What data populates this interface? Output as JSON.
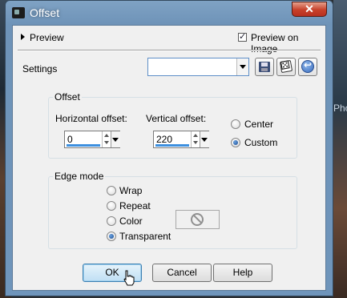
{
  "window": {
    "title": "Offset",
    "close_label": "✕"
  },
  "preview": {
    "label": "Preview",
    "preview_on_image_label": "Preview on Image",
    "preview_on_image_checked": true
  },
  "settings": {
    "label": "Settings",
    "selected": ""
  },
  "offset_group": {
    "title": "Offset",
    "horizontal_label": "Horizontal offset:",
    "horizontal_value": "0",
    "vertical_label": "Vertical offset:",
    "vertical_value": "220",
    "center_label": "Center",
    "custom_label": "Custom",
    "selected": "Custom"
  },
  "edge_group": {
    "title": "Edge mode",
    "wrap_label": "Wrap",
    "repeat_label": "Repeat",
    "color_label": "Color",
    "transparent_label": "Transparent",
    "selected": "Transparent"
  },
  "buttons": {
    "ok": "OK",
    "cancel": "Cancel",
    "help": "Help"
  },
  "background": {
    "right_text": "Pho"
  },
  "colors": {
    "accent": "#3c8fdf",
    "title_bar": "#6e93b8",
    "close": "#c7402a"
  }
}
